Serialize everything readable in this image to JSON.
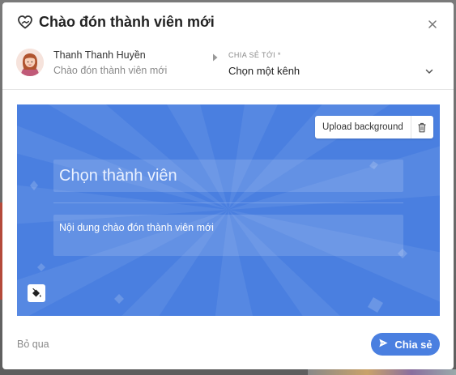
{
  "dialog": {
    "title": "Chào đón thành viên mới",
    "title_icon": "heart-hand-icon",
    "close_icon": "close-icon"
  },
  "sender": {
    "name": "Thanh Thanh Huyền",
    "subtitle": "Chào đón thành viên mới",
    "avatar": "avatar-icon"
  },
  "share": {
    "label": "CHIA SẺ TỚI *",
    "channel_value": "Chọn một kênh",
    "chevron_icon": "chevron-down-icon"
  },
  "card": {
    "upload_label": "Upload background",
    "trash_icon": "trash-icon",
    "member_placeholder": "Chọn thành viên",
    "message_placeholder": "Nội dung chào đón thành viên mới",
    "paint_icon": "paint-bucket-icon",
    "background_color": "#4a7fe0"
  },
  "footer": {
    "skip_label": "Bỏ qua",
    "share_label": "Chia sẻ",
    "send_icon": "send-icon"
  },
  "colors": {
    "accent": "#4a7fe0",
    "text": "#222222",
    "muted": "#8a8a8a"
  }
}
